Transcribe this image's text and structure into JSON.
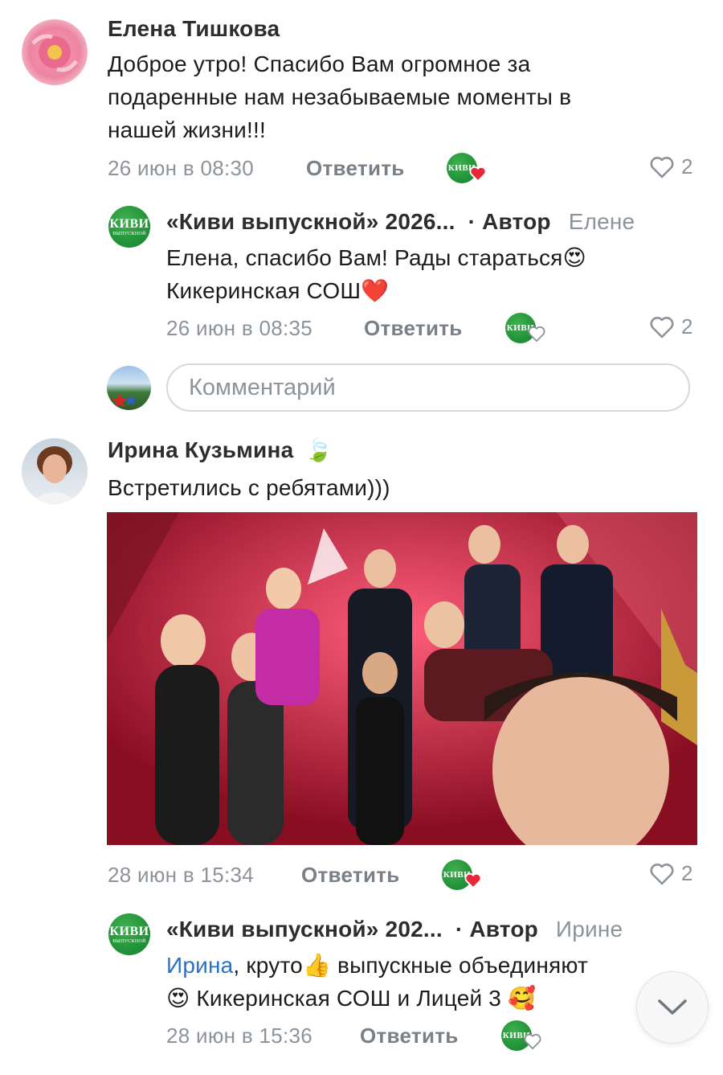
{
  "comments": [
    {
      "author": "Елена Тишкова",
      "text": "Доброе утро! Спасибо Вам огромное за подаренные нам незабываемые моменты в нашей жизни!!!",
      "lines": [
        "Доброе утро! Спасибо Вам огромное за",
        "подаренные нам незабываемые моменты в",
        "нашей жизни!!!"
      ],
      "time": "26 июн в 08:30",
      "reply_label": "Ответить",
      "likes": "2",
      "avatar_icon": "peony-flower-avatar",
      "reply": {
        "author": "«Киви выпускной» 2026...",
        "badge": "· Автор",
        "to": "Елене",
        "line1": "Елена, спасибо Вам! Рады стараться",
        "line2": "Кикеринская СОШ",
        "time": "26 июн в 08:35",
        "reply_label": "Ответить",
        "likes": "2"
      }
    },
    {
      "author": "Ирина Кузьмина",
      "text": "Встретились с ребятами)))",
      "time": "28 июн в 15:34",
      "reply_label": "Ответить",
      "likes": "2",
      "avatar_icon": "woman-portrait-avatar",
      "photo_alt": "Group selfie of graduates in front of red sequin wall",
      "reply": {
        "author": "«Киви выпускной» 202...",
        "badge": "· Автор",
        "to": "Ирине",
        "mention": "Ирина",
        "line1_rest": ", круто",
        "line1_end": " выпускные объединяют",
        "line2": " Кикеринская СОШ и Лицей 3",
        "time": "28 июн в 15:36",
        "reply_label": "Ответить"
      }
    }
  ],
  "composer": {
    "placeholder": "Комментарий"
  },
  "kiwi_logo": {
    "line1": "КИВИ",
    "line2": "ВЫПУСКНОЙ"
  },
  "colors": {
    "kiwi_green": "#1f8e36",
    "mention_blue": "#2a72c9",
    "like_red": "#e8273a"
  }
}
